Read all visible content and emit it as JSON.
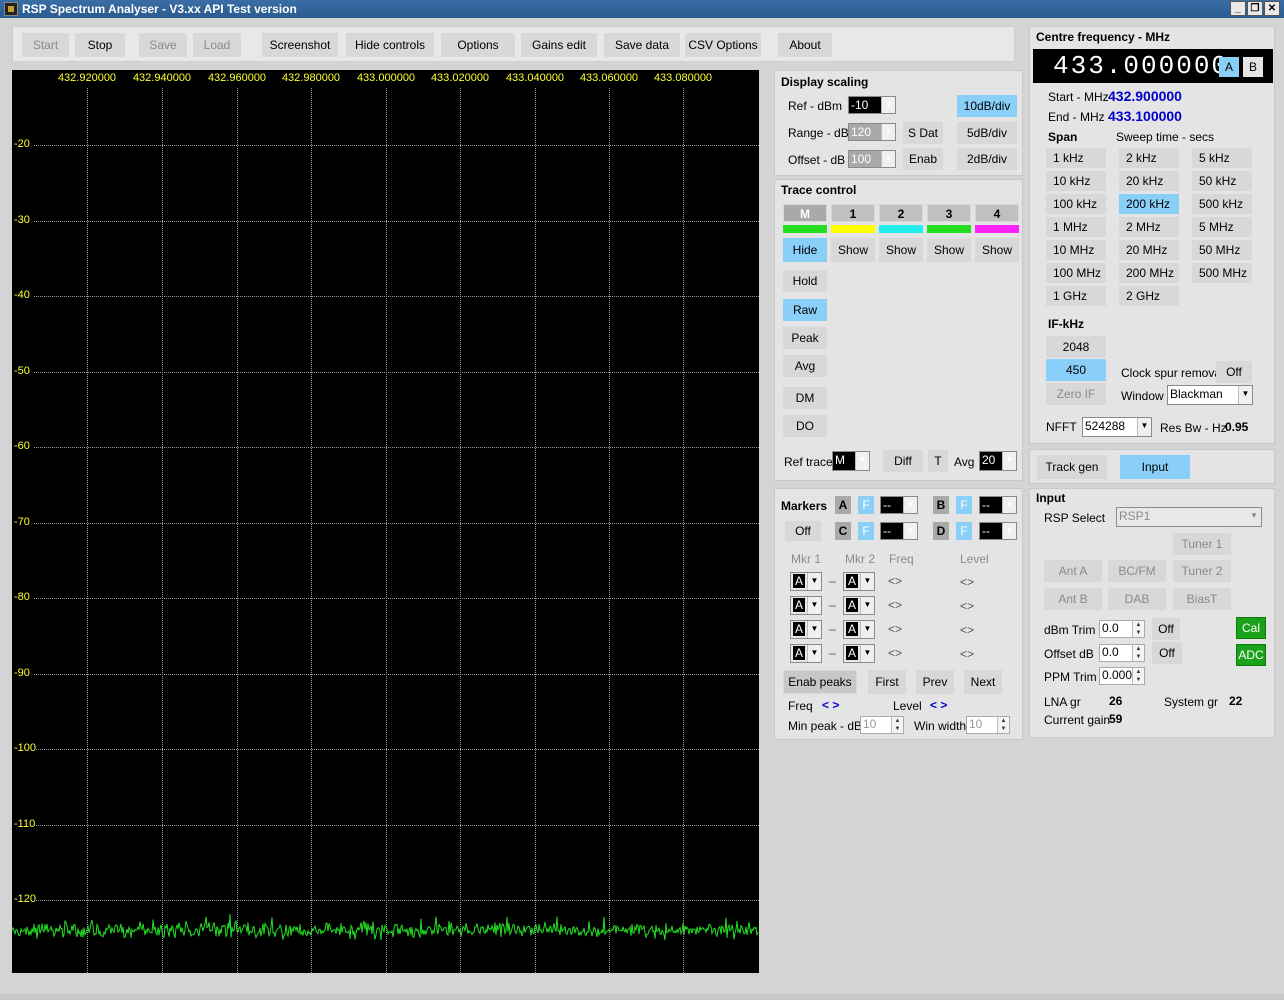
{
  "window": {
    "title": "RSP Spectrum Analyser - V3.xx API Test version"
  },
  "toolbar": {
    "start": "Start",
    "stop": "Stop",
    "save": "Save",
    "load": "Load",
    "screenshot": "Screenshot",
    "hide_controls": "Hide controls",
    "options": "Options",
    "gains_edit": "Gains edit",
    "save_data": "Save data",
    "csv_options": "CSV Options",
    "about": "About"
  },
  "plot": {
    "freq_labels": [
      "432.920000",
      "432.940000",
      "432.960000",
      "432.980000",
      "433.000000",
      "433.020000",
      "433.040000",
      "433.060000",
      "433.080000"
    ],
    "db_labels": [
      "-20",
      "-30",
      "-40",
      "-50",
      "-60",
      "-70",
      "-80",
      "-90",
      "-100",
      "-110",
      "-120"
    ],
    "trace_color": "#22e022",
    "noise_floor_db": -124,
    "ref_db": -10,
    "db_per_div": 10
  },
  "display_scaling": {
    "title": "Display scaling",
    "ref_label": "Ref - dBm",
    "ref_value": "-10",
    "range_label": "Range - dB",
    "range_value": "120",
    "offset_label": "Offset - dB",
    "offset_value": "100",
    "sdat": "S Dat",
    "enab": "Enab",
    "div10": "10dB/div",
    "div5": "5dB/div",
    "div2": "2dB/div"
  },
  "trace_control": {
    "title": "Trace control",
    "traces": [
      {
        "label": "M",
        "color": "#22dd22",
        "action": "Hide"
      },
      {
        "label": "1",
        "color": "#ffff00",
        "action": "Show"
      },
      {
        "label": "2",
        "color": "#22eeee",
        "action": "Show"
      },
      {
        "label": "3",
        "color": "#22dd22",
        "action": "Show"
      },
      {
        "label": "4",
        "color": "#ff22ff",
        "action": "Show"
      }
    ],
    "hold": "Hold",
    "raw": "Raw",
    "peak": "Peak",
    "avg": "Avg",
    "dm": "DM",
    "do": "DO",
    "ref_trace_label": "Ref trace",
    "ref_trace_value": "M",
    "diff": "Diff",
    "t": "T",
    "avg_label": "Avg",
    "avg_value": "20"
  },
  "markers": {
    "title": "Markers",
    "off": "Off",
    "a": "A",
    "b": "B",
    "c": "C",
    "d": "D",
    "f": "F",
    "dash": "--",
    "col_mkr1": "Mkr 1",
    "col_mkr2": "Mkr 2",
    "col_freq": "Freq",
    "col_level": "Level",
    "rows": [
      {
        "m1": "A",
        "m2": "A",
        "freq": "<>",
        "level": "<>"
      },
      {
        "m1": "A",
        "m2": "A",
        "freq": "<>",
        "level": "<>"
      },
      {
        "m1": "A",
        "m2": "A",
        "freq": "<>",
        "level": "<>"
      },
      {
        "m1": "A",
        "m2": "A",
        "freq": "<>",
        "level": "<>"
      }
    ],
    "row_dash": "–",
    "enab_peaks": "Enab peaks",
    "first": "First",
    "prev": "Prev",
    "next": "Next",
    "freq_label": "Freq",
    "freq_nav": "< >",
    "level_label": "Level",
    "level_nav": "< >",
    "min_peak_label": "Min peak - dB",
    "min_peak_value": "10",
    "win_width_label": "Win width",
    "win_width_value": "10"
  },
  "centre": {
    "title": "Centre frequency - MHz",
    "value": "433.000000",
    "a": "A",
    "b": "B",
    "start_label": "Start - MHz",
    "start_value": "432.900000",
    "end_label": "End - MHz",
    "end_value": "433.100000",
    "span_title": "Span",
    "sweep_title": "Sweep time - secs",
    "spans": [
      "1 kHz",
      "2 kHz",
      "5 kHz",
      "10 kHz",
      "20 kHz",
      "50 kHz",
      "100 kHz",
      "200 kHz",
      "500 kHz",
      "1 MHz",
      "2 MHz",
      "5 MHz",
      "10 MHz",
      "20 MHz",
      "50 MHz",
      "100 MHz",
      "200 MHz",
      "500 MHz",
      "1 GHz",
      "2 GHz"
    ],
    "selected_span": "200 kHz",
    "if_title": "IF-kHz",
    "if_2048": "2048",
    "if_450": "450",
    "zero_if": "Zero IF",
    "clock_spur_label": "Clock spur removal",
    "clock_spur_value": "Off",
    "window_label": "Window",
    "window_value": "Blackman",
    "nfft_label": "NFFT",
    "nfft_value": "524288",
    "resbw_label": "Res Bw - Hz",
    "resbw_value": "0.95"
  },
  "tabs": {
    "track_gen": "Track gen",
    "input": "Input"
  },
  "input": {
    "title": "Input",
    "rsp_select_label": "RSP Select",
    "rsp_select_value": "RSP1",
    "tuner1": "Tuner 1",
    "ant_a": "Ant A",
    "bcfm": "BC/FM",
    "tuner2": "Tuner 2",
    "ant_b": "Ant B",
    "dab": "DAB",
    "biast": "BiasT",
    "dbm_trim_label": "dBm Trim",
    "dbm_trim_value": "0.0",
    "dbm_trim_state": "Off",
    "offset_db_label": "Offset dB",
    "offset_db_value": "0.0",
    "offset_db_state": "Off",
    "ppm_trim_label": "PPM Trim",
    "ppm_trim_value": "0.000",
    "cal": "Cal",
    "adc": "ADC",
    "lna_gr_label": "LNA gr",
    "lna_gr_value": "26",
    "system_gr_label": "System gr",
    "system_gr_value": "22",
    "current_gain_label": "Current gain",
    "current_gain_value": "59"
  }
}
